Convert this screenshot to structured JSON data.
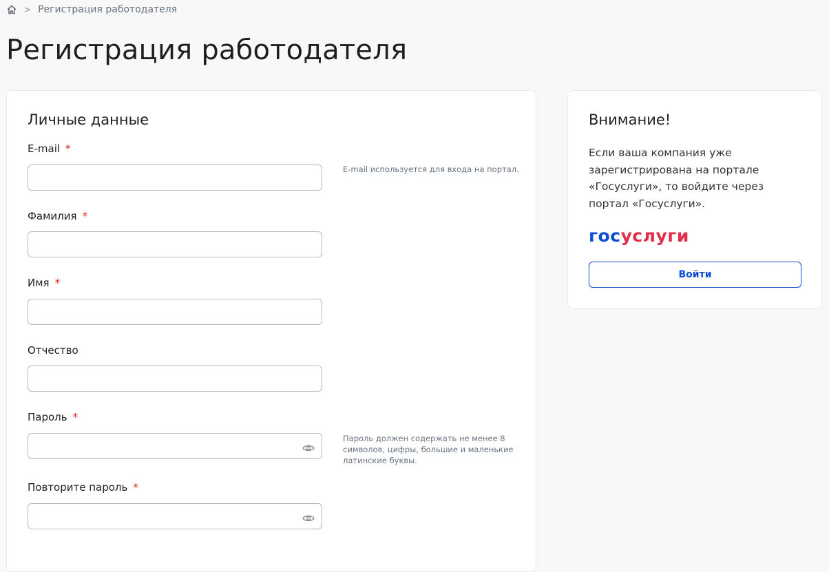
{
  "breadcrumb": {
    "separator": ">",
    "current": "Регистрация работодателя"
  },
  "page": {
    "title": "Регистрация работодателя"
  },
  "form": {
    "section_title": "Личные данные",
    "required_mark": "*",
    "fields": [
      {
        "label": "E-mail",
        "required": true,
        "value": "",
        "hint": "E-mail используется для входа на портал."
      },
      {
        "label": "Фамилия",
        "required": true,
        "value": ""
      },
      {
        "label": "Имя",
        "required": true,
        "value": ""
      },
      {
        "label": "Отчество",
        "required": false,
        "value": ""
      },
      {
        "label": "Пароль",
        "required": true,
        "value": "",
        "hint": "Пароль должен содержать не менее 8 символов, цифры, большие и маленькие латинские буквы."
      },
      {
        "label": "Повторите пароль",
        "required": true,
        "value": ""
      }
    ]
  },
  "notice": {
    "title": "Внимание!",
    "text": "Если ваша компания уже зарегистрирована на портале «Госуслуги», то войдите через портал «Госуслуги».",
    "logo_part1": "гос",
    "logo_part2": "услуги",
    "login_label": "Войти"
  },
  "colors": {
    "accent_blue": "#0d4cd3",
    "logo_red": "#e22d4b",
    "required_red": "#e02020",
    "page_bg": "#f8f8f8"
  },
  "icons": {
    "home": "home-icon",
    "eye": "eye-icon"
  }
}
